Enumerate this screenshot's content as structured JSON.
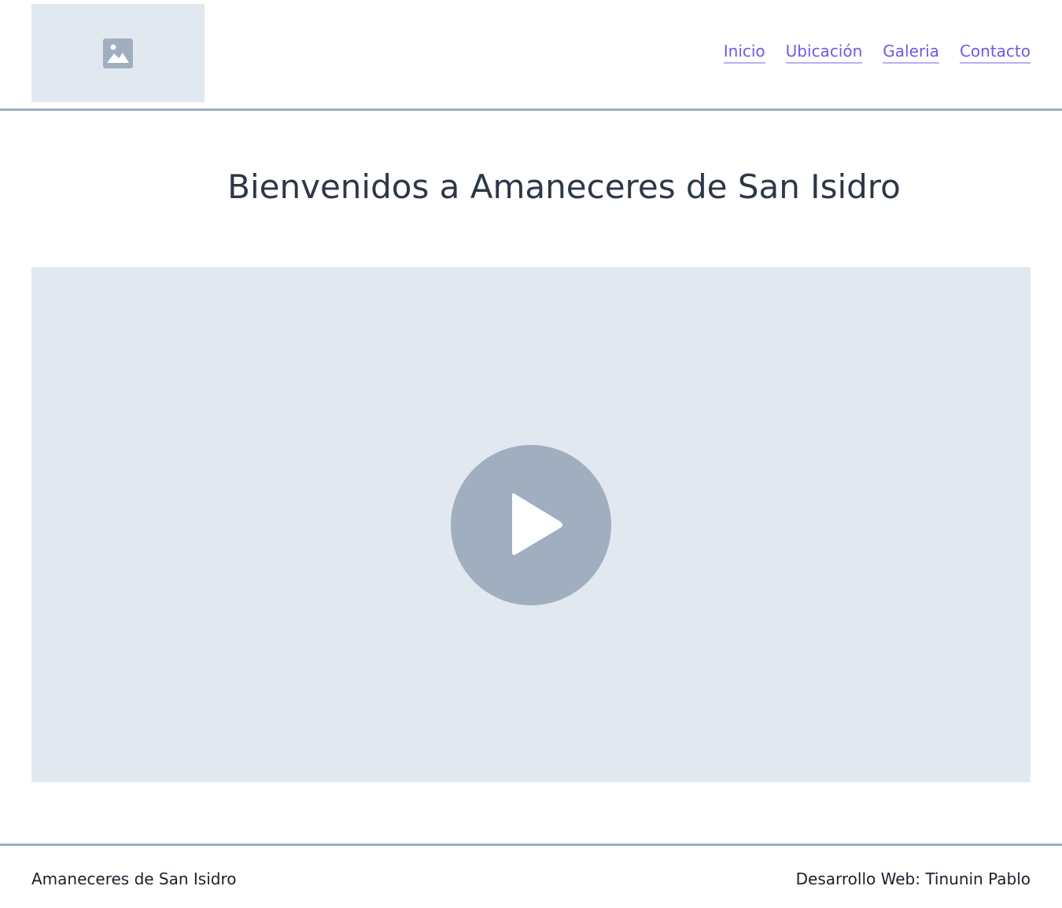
{
  "header": {
    "logo_icon": "image-placeholder-icon",
    "nav": [
      {
        "label": "Inicio"
      },
      {
        "label": "Ubicación"
      },
      {
        "label": "Galeria"
      },
      {
        "label": "Contacto"
      }
    ]
  },
  "main": {
    "title": "Bienvenidos a Amaneceres de San Isidro",
    "video": {
      "play_icon": "play-icon"
    }
  },
  "footer": {
    "left": "Amaneceres de San Isidro",
    "right": "Desarrollo Web: Tinunin Pablo"
  },
  "colors": {
    "link": "#6b5ce7",
    "placeholder_bg": "#e2e8f0",
    "placeholder_fg": "#a0aec0",
    "divider": "#a0aec0",
    "text": "#2d3748"
  }
}
